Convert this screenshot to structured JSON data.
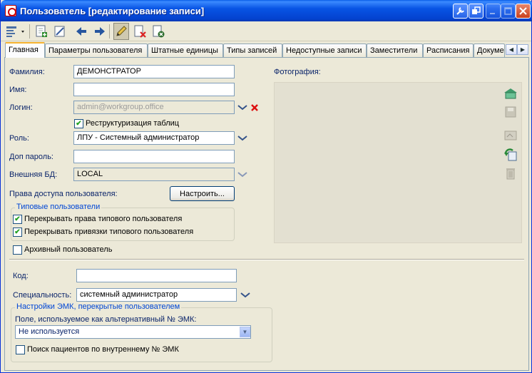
{
  "window": {
    "title": "Пользователь [редактирование записи]",
    "controls": [
      "tools-icon",
      "restore-window-icon",
      "minimize-icon",
      "maximize-icon",
      "close-icon"
    ]
  },
  "toolbar": {
    "icons": [
      "view-options-icon",
      "new-record-icon",
      "edit-record-icon",
      "back-arrow-icon",
      "forward-arrow-icon",
      "pencil-icon",
      "delete-record-icon",
      "cancel-record-icon"
    ]
  },
  "tabs": [
    {
      "label": "Главная",
      "selected": true
    },
    {
      "label": "Параметры пользователя"
    },
    {
      "label": "Штатные единицы"
    },
    {
      "label": "Типы записей"
    },
    {
      "label": "Недоступные записи"
    },
    {
      "label": "Заместители"
    },
    {
      "label": "Расписания"
    },
    {
      "label": "Докуме"
    }
  ],
  "form": {
    "surname_label": "Фамилия:",
    "surname_value": "ДЕМОНСТРАТОР",
    "name_label": "Имя:",
    "name_value": "",
    "login_label": "Логин:",
    "login_value": "admin@workgroup.office",
    "restructure_label": "Реструктуризация таблиц",
    "restructure_checked": true,
    "role_label": "Роль:",
    "role_value": "ЛПУ - Системный администратор",
    "extra_password_label": "Доп пароль:",
    "extra_password_value": "",
    "external_db_label": "Внешняя БД:",
    "external_db_value": "LOCAL",
    "access_rights_label": "Права доступа пользователя:",
    "configure_button": "Настроить...",
    "typical_users_group": "Типовые пользователи",
    "override_rights_label": "Перекрывать права типового пользователя",
    "override_rights_checked": true,
    "override_bindings_label": "Перекрывать привязки типового пользователя",
    "override_bindings_checked": true,
    "archive_user_label": "Архивный пользователь",
    "archive_user_checked": false,
    "photo_label": "Фотография:",
    "code_label": "Код:",
    "code_value": "",
    "specialty_label": "Специальность:",
    "specialty_value": "системный администратор",
    "emk_group": "Настройки ЭМК, перекрытые пользователем",
    "alt_emk_label": "Поле, используемое как альтернативный № ЭМК:",
    "alt_emk_value": "Не используется",
    "internal_search_label": "Поиск пациентов по внутреннему № ЭМК",
    "internal_search_checked": false
  },
  "photo_actions": [
    "load-photo-icon",
    "save-photo-icon",
    "scan-photo-icon",
    "refresh-photo-icon",
    "trash-photo-icon"
  ],
  "colors": {
    "titlebar": "#0854e4",
    "window_bg": "#ece9d8",
    "field_border": "#7f9db9",
    "label_blue": "#0a246a",
    "group_title": "#0046d5",
    "tab_highlight": "#f6b330"
  }
}
